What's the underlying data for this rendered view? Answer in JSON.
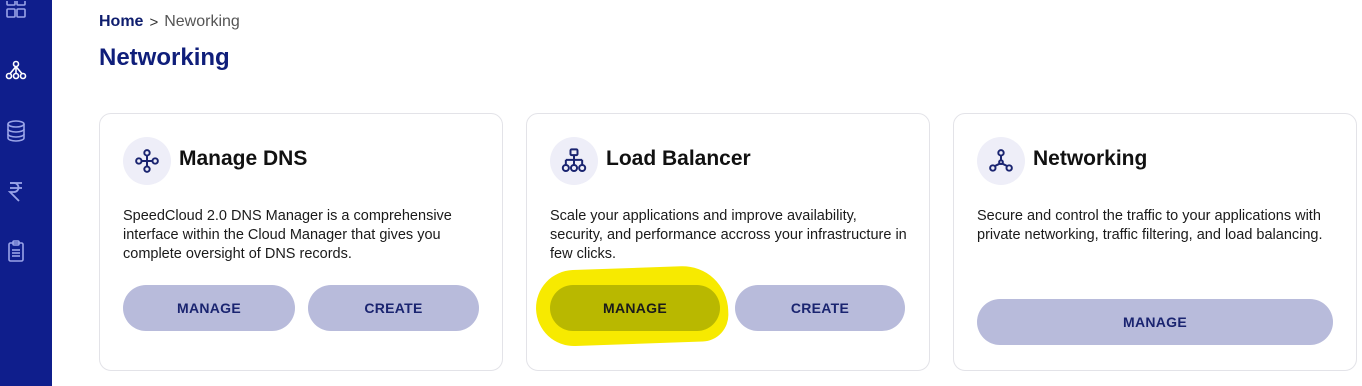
{
  "sidebar": {
    "items": [
      {
        "icon": "grid-icon"
      },
      {
        "icon": "network-icon"
      },
      {
        "icon": "database-icon"
      },
      {
        "icon": "rupee-icon"
      },
      {
        "icon": "clipboard-icon"
      }
    ],
    "background": "#0f1e8c"
  },
  "breadcrumb": {
    "home": "Home",
    "separator": ">",
    "current": "Neworking"
  },
  "page": {
    "title": "Networking"
  },
  "cards": [
    {
      "icon": "dns-network-icon",
      "title": "Manage DNS",
      "description": "SpeedCloud 2.0 DNS Manager is a comprehensive interface within the Cloud Manager that gives you complete oversight of DNS records.",
      "buttons": [
        "MANAGE",
        "CREATE"
      ]
    },
    {
      "icon": "load-balancer-icon",
      "title": "Load Balancer",
      "description": "Scale your applications and improve availability, security, and performance accross your infrastructure in few clicks.",
      "buttons": [
        "MANAGE",
        "CREATE"
      ]
    },
    {
      "icon": "networking-icon",
      "title": "Networking",
      "description": "Secure and control the traffic to your applications with private networking, traffic filtering, and load balancing.",
      "buttons": [
        "MANAGE"
      ]
    }
  ],
  "colors": {
    "accent": "#0f1e8c",
    "button": "#b8bbdb",
    "highlight": "#f7ea00"
  }
}
